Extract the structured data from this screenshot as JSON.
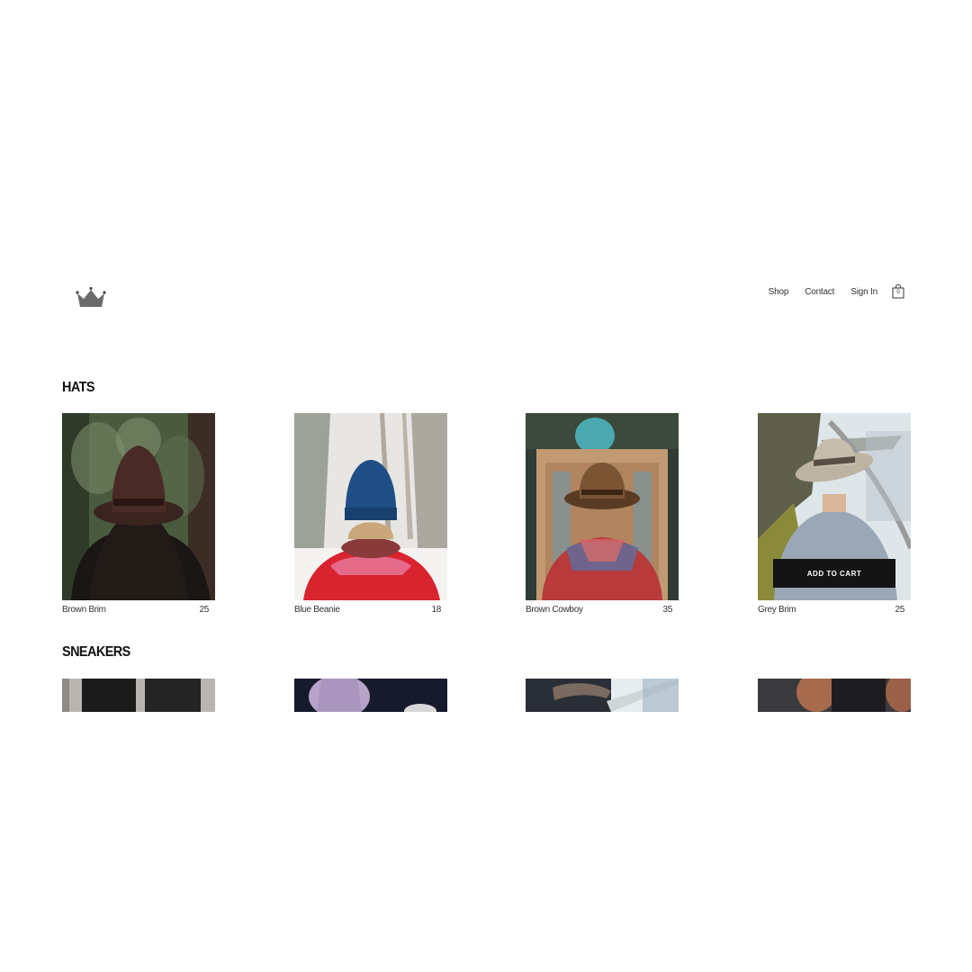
{
  "nav": {
    "shop": "Shop",
    "contact": "Contact",
    "signin": "Sign In",
    "cart_count": "0"
  },
  "sections": {
    "hats": {
      "title": "HATS",
      "products": [
        {
          "name": "Brown Brim",
          "price": "25"
        },
        {
          "name": "Blue Beanie",
          "price": "18"
        },
        {
          "name": "Brown Cowboy",
          "price": "35"
        },
        {
          "name": "Grey Brim",
          "price": "25",
          "button": "ADD TO CART"
        }
      ]
    },
    "sneakers": {
      "title": "SNEAKERS"
    }
  },
  "icons": {
    "logo": "crown-icon",
    "cart": "shopping-bag-icon"
  },
  "colors": {
    "button_bg": "#141414",
    "logo": "#6b6b6b"
  }
}
